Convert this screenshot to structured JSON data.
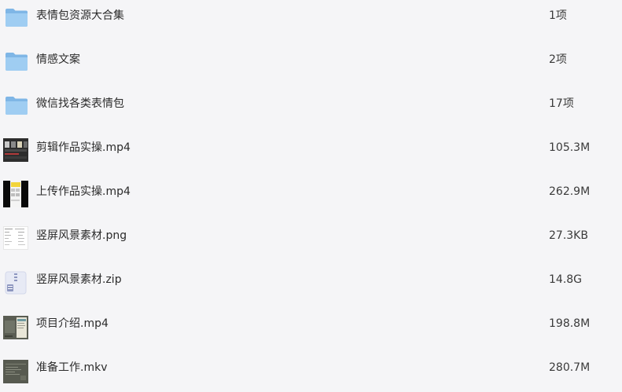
{
  "files": [
    {
      "name": "表情包资源大合集",
      "size": "1项",
      "icon": "folder-icon"
    },
    {
      "name": "情感文案",
      "size": "2项",
      "icon": "folder-icon"
    },
    {
      "name": "微信找各类表情包",
      "size": "17项",
      "icon": "folder-icon"
    },
    {
      "name": "剪辑作品实操.mp4",
      "size": "105.3M",
      "icon": "video-thumbnail"
    },
    {
      "name": "上传作品实操.mp4",
      "size": "262.9M",
      "icon": "video-thumbnail"
    },
    {
      "name": "竖屏风景素材.png",
      "size": "27.3KB",
      "icon": "image-thumbnail"
    },
    {
      "name": "竖屏风景素材.zip",
      "size": "14.8G",
      "icon": "zip-icon"
    },
    {
      "name": "项目介绍.mp4",
      "size": "198.8M",
      "icon": "video-thumbnail"
    },
    {
      "name": "准备工作.mkv",
      "size": "280.7M",
      "icon": "video-thumbnail"
    }
  ],
  "colors": {
    "background": "#f5f5f7",
    "text": "#2b2b2b",
    "folder_blue": "#8ec3ee"
  }
}
